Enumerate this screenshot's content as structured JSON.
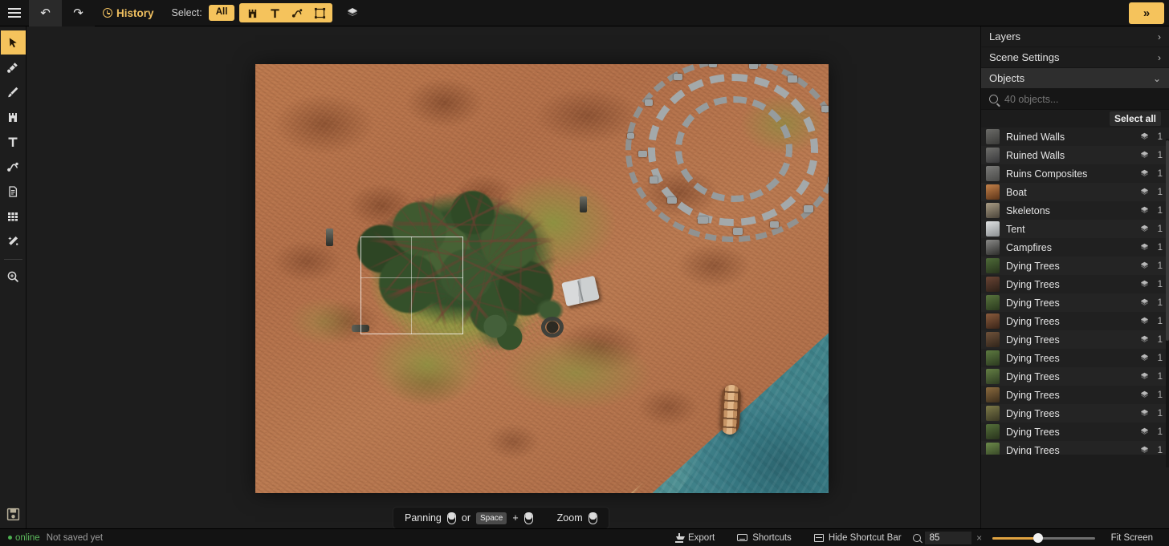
{
  "app": {
    "accent": "#f5c35c",
    "background": "#1d1d1d"
  },
  "topbar": {
    "menu_icon": "hamburger-icon",
    "undo_icon": "undo-arrow-icon",
    "redo_icon": "redo-arrow-icon",
    "history_label": "History",
    "history_icon": "clock-icon",
    "select_label": "Select:",
    "select_all_pill": "All",
    "filter_icons": [
      "asset-tower-icon",
      "text-T-icon",
      "path-node-icon",
      "frame-rect-icon"
    ],
    "layers_icon": "layers-stack-icon",
    "expand_label": "»"
  },
  "left_toolbar": {
    "tools": [
      {
        "name": "select-cursor-tool",
        "icon": "cursor-arrow-icon",
        "active": true
      },
      {
        "name": "shovel-tool",
        "icon": "shovel-icon",
        "active": false
      },
      {
        "name": "brush-tool",
        "icon": "paintbrush-icon",
        "active": false
      },
      {
        "name": "asset-tool",
        "icon": "tower-icon",
        "active": false
      },
      {
        "name": "text-tool",
        "icon": "text-T-icon",
        "active": false
      },
      {
        "name": "path-tool",
        "icon": "path-node-icon",
        "active": false
      },
      {
        "name": "note-tool",
        "icon": "document-icon",
        "active": false
      },
      {
        "name": "grid-tool",
        "icon": "grid-icon",
        "active": false
      },
      {
        "name": "effects-tool",
        "icon": "magic-wand-icon",
        "active": false
      },
      {
        "name": "zoom-tool",
        "icon": "magnifier-icon",
        "active": false
      }
    ],
    "save_icon": "floppy-save-icon"
  },
  "canvas": {
    "shortcut_bar": {
      "panning_label": "Panning",
      "or_label": "or",
      "space_key": "Space",
      "plus": "+",
      "zoom_label": "Zoom",
      "mouse_icon": "mouse-icon"
    },
    "selection_rect": true
  },
  "right_panel": {
    "sections": [
      {
        "label": "Layers",
        "chevron": "›",
        "active": false
      },
      {
        "label": "Scene Settings",
        "chevron": "›",
        "active": false
      },
      {
        "label": "Objects",
        "chevron": "⌄",
        "active": true
      }
    ],
    "search": {
      "icon": "search-icon",
      "value": "",
      "placeholder": "40 objects..."
    },
    "select_all_label": "Select all",
    "objects": [
      {
        "name": "Ruined Walls",
        "count": "1",
        "thumb": "linear-gradient(160deg,#6b6b68,#3a3a38)"
      },
      {
        "name": "Ruined Walls",
        "count": "1",
        "thumb": "linear-gradient(160deg,#6f6f6c,#38383a)"
      },
      {
        "name": "Ruins Composites",
        "count": "1",
        "thumb": "linear-gradient(160deg,#7a7a78,#4a4a48)"
      },
      {
        "name": "Boat",
        "count": "1",
        "thumb": "linear-gradient(160deg,#c4824a,#5c3418)"
      },
      {
        "name": "Skeletons",
        "count": "1",
        "thumb": "linear-gradient(160deg,#a99c84,#4a443a)"
      },
      {
        "name": "Tent",
        "count": "1",
        "thumb": "linear-gradient(160deg,#e0e2e3,#8c9092)"
      },
      {
        "name": "Campfires",
        "count": "1",
        "thumb": "linear-gradient(160deg,#8a8a88,#2e2e2c)"
      },
      {
        "name": "Dying Trees",
        "count": "1",
        "thumb": "linear-gradient(160deg,#4e6b38,#27331c)"
      },
      {
        "name": "Dying Trees",
        "count": "1",
        "thumb": "linear-gradient(160deg,#6a4434,#2c2018)"
      },
      {
        "name": "Dying Trees",
        "count": "1",
        "thumb": "linear-gradient(160deg,#59743d,#2a3a1e)"
      },
      {
        "name": "Dying Trees",
        "count": "1",
        "thumb": "linear-gradient(160deg,#8a5b3c,#3a2418)"
      },
      {
        "name": "Dying Trees",
        "count": "1",
        "thumb": "linear-gradient(160deg,#70523a,#30241a)"
      },
      {
        "name": "Dying Trees",
        "count": "1",
        "thumb": "linear-gradient(160deg,#5d7a40,#2c3a20)"
      },
      {
        "name": "Dying Trees",
        "count": "1",
        "thumb": "linear-gradient(160deg,#647f44,#2e3c22)"
      },
      {
        "name": "Dying Trees",
        "count": "1",
        "thumb": "linear-gradient(160deg,#8a6a3e,#3c2e1c)"
      },
      {
        "name": "Dying Trees",
        "count": "1",
        "thumb": "linear-gradient(160deg,#7d7a48,#3a3824)"
      },
      {
        "name": "Dying Trees",
        "count": "1",
        "thumb": "linear-gradient(160deg,#55703a,#28331c)"
      },
      {
        "name": "Dying Trees",
        "count": "1",
        "thumb": "linear-gradient(160deg,#6c8a4a,#303e22)"
      }
    ],
    "layers_icon": "layers-stack-icon"
  },
  "bottom_bar": {
    "online_label": "online",
    "save_status": "Not saved yet",
    "export_label": "Export",
    "export_icon": "download-icon",
    "shortcuts_label": "Shortcuts",
    "shortcuts_icon": "keyboard-icon",
    "hide_shortcut_label": "Hide Shortcut Bar",
    "hide_shortcut_icon": "window-icon",
    "zoom_icon": "magnifier-icon",
    "zoom_value": "85",
    "zoom_clear": "×",
    "fit_screen_label": "Fit Screen"
  }
}
